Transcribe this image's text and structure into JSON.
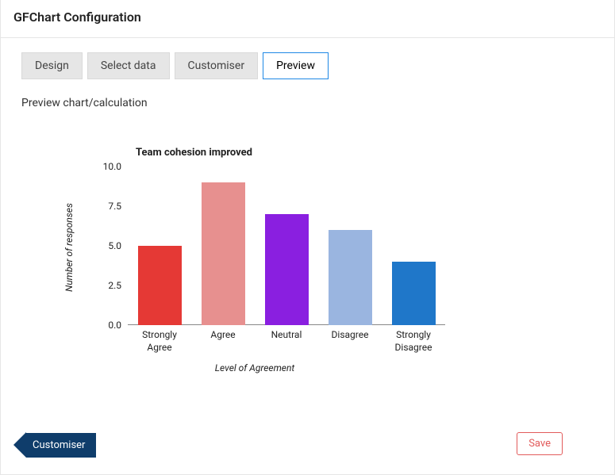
{
  "header": {
    "title": "GFChart Configuration"
  },
  "tabs": [
    {
      "label": "Design",
      "active": false
    },
    {
      "label": "Select data",
      "active": false
    },
    {
      "label": "Customiser",
      "active": false
    },
    {
      "label": "Preview",
      "active": true
    }
  ],
  "subtitle": "Preview chart/calculation",
  "footer": {
    "back_label": "Customiser",
    "save_label": "Save"
  },
  "chart_data": {
    "type": "bar",
    "title": "Team cohesion improved",
    "xlabel": "Level of Agreement",
    "ylabel": "Number of responses",
    "ylim": [
      0,
      10
    ],
    "yticks": [
      0.0,
      2.5,
      5.0,
      7.5,
      10.0
    ],
    "categories": [
      "Strongly Agree",
      "Agree",
      "Neutral",
      "Disagree",
      "Strongly Disagree"
    ],
    "values": [
      5,
      9,
      7,
      6,
      4
    ],
    "colors": [
      "#e53935",
      "#e7908f",
      "#8a1fe0",
      "#9ab5e0",
      "#1f77c9"
    ]
  }
}
